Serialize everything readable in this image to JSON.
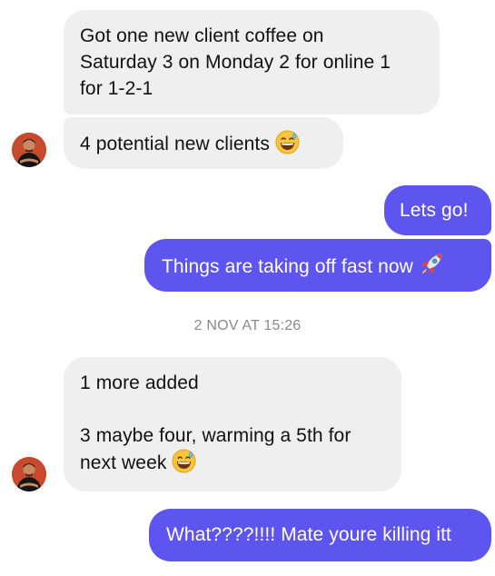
{
  "conversation": {
    "messages": [
      {
        "direction": "incoming",
        "lines": [
          "Got one new client coffee on",
          "Saturday 3 on Monday 2 for online 1",
          "for 1-2-1"
        ]
      },
      {
        "direction": "incoming",
        "text": "4 potential new clients",
        "emoji": "grinning-face-with-sweat-icon"
      },
      {
        "direction": "outgoing",
        "text": "Lets go!"
      },
      {
        "direction": "outgoing",
        "text": "Things are taking off fast now",
        "emoji": "rocket-icon"
      },
      {
        "direction": "incoming",
        "lines": [
          "1 more added",
          "",
          "3 maybe four, warming a 5th for",
          "next week"
        ],
        "emoji": "grinning-face-with-sweat-icon"
      },
      {
        "direction": "outgoing",
        "text": "What????!!!! Mate youre killing itt"
      }
    ],
    "timestamp": "2 NOV AT 15:26"
  },
  "colors": {
    "incoming_bubble": "#efefef",
    "outgoing_bubble": "#5e54f0",
    "timestamp_text": "#8a8a8a"
  }
}
